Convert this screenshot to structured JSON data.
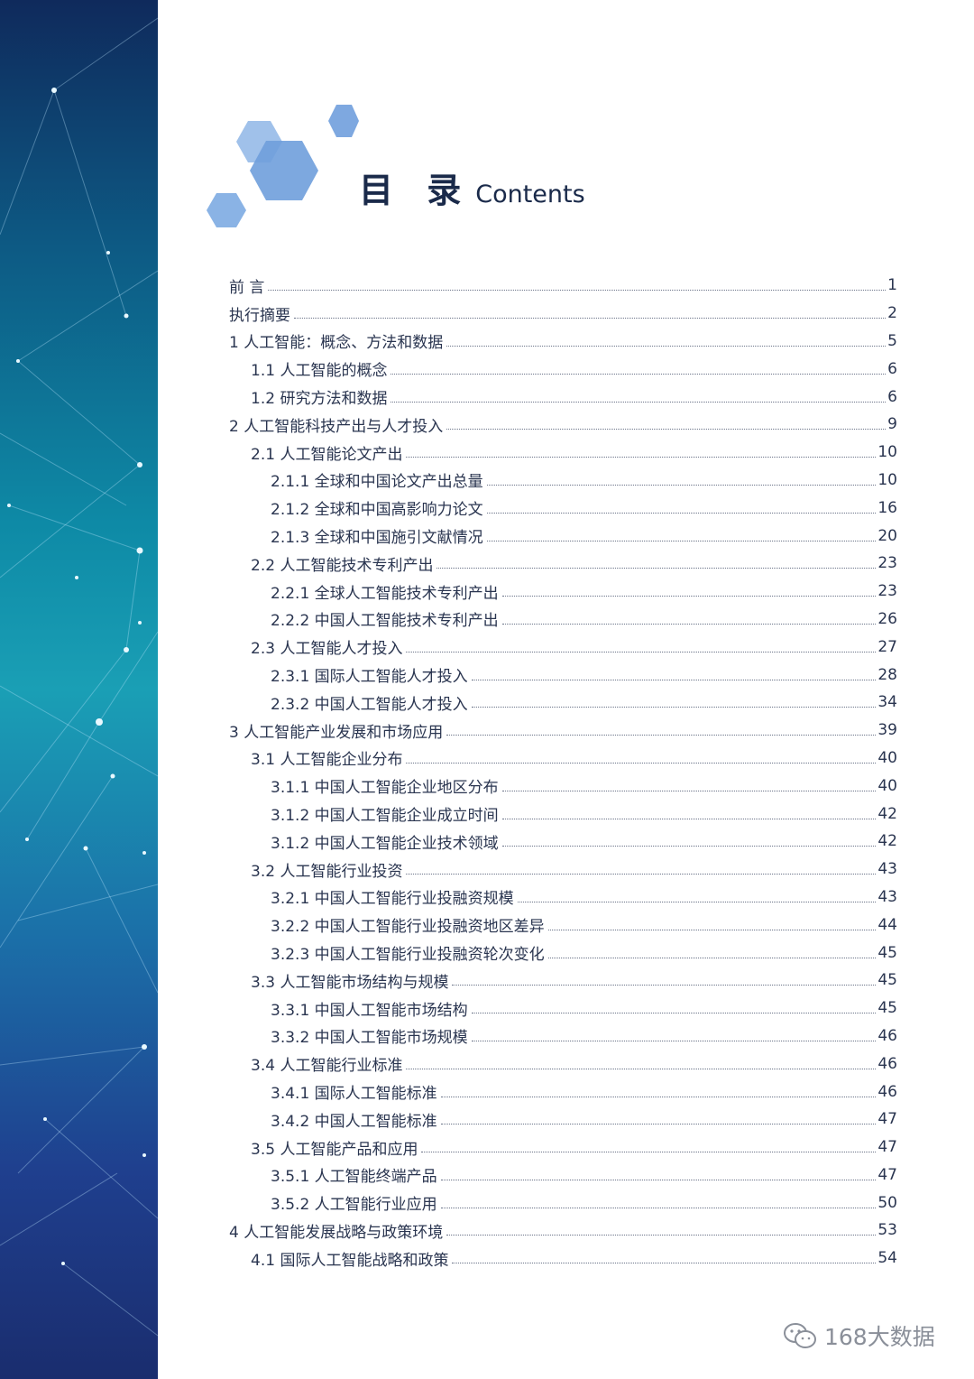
{
  "header": {
    "title_cn": "目 录",
    "title_en": "Contents"
  },
  "toc": [
    {
      "level": 1,
      "label": "前  言",
      "page": "1"
    },
    {
      "level": 1,
      "label": "执行摘要",
      "page": "2"
    },
    {
      "level": 1,
      "label": "1 人工智能：概念、方法和数据",
      "page": "5"
    },
    {
      "level": 2,
      "label": "1.1 人工智能的概念",
      "page": "6"
    },
    {
      "level": 2,
      "label": "1.2 研究方法和数据",
      "page": "6"
    },
    {
      "level": 1,
      "label": "2 人工智能科技产出与人才投入",
      "page": "9"
    },
    {
      "level": 2,
      "label": "2.1 人工智能论文产出",
      "page": "10"
    },
    {
      "level": 3,
      "label": "2.1.1 全球和中国论文产出总量",
      "page": "10"
    },
    {
      "level": 3,
      "label": "2.1.2 全球和中国高影响力论文",
      "page": "16"
    },
    {
      "level": 3,
      "label": "2.1.3 全球和中国施引文献情况",
      "page": "20"
    },
    {
      "level": 2,
      "label": "2.2 人工智能技术专利产出",
      "page": "23"
    },
    {
      "level": 3,
      "label": "2.2.1 全球人工智能技术专利产出",
      "page": "23"
    },
    {
      "level": 3,
      "label": "2.2.2 中国人工智能技术专利产出",
      "page": "26"
    },
    {
      "level": 2,
      "label": "2.3 人工智能人才投入",
      "page": "27"
    },
    {
      "level": 3,
      "label": "2.3.1 国际人工智能人才投入",
      "page": "28"
    },
    {
      "level": 3,
      "label": "2.3.2 中国人工智能人才投入",
      "page": "34"
    },
    {
      "level": 1,
      "label": "3 人工智能产业发展和市场应用",
      "page": "39"
    },
    {
      "level": 2,
      "label": "3.1 人工智能企业分布",
      "page": "40"
    },
    {
      "level": 3,
      "label": "3.1.1 中国人工智能企业地区分布",
      "page": "40"
    },
    {
      "level": 3,
      "label": "3.1.2 中国人工智能企业成立时间",
      "page": "42"
    },
    {
      "level": 3,
      "label": "3.1.2 中国人工智能企业技术领域",
      "page": "42"
    },
    {
      "level": 2,
      "label": "3.2 人工智能行业投资",
      "page": "43"
    },
    {
      "level": 3,
      "label": "3.2.1 中国人工智能行业投融资规模",
      "page": "43"
    },
    {
      "level": 3,
      "label": "3.2.2 中国人工智能行业投融资地区差异",
      "page": "44"
    },
    {
      "level": 3,
      "label": "3.2.3 中国人工智能行业投融资轮次变化",
      "page": "45"
    },
    {
      "level": 2,
      "label": "3.3 人工智能市场结构与规模",
      "page": "45"
    },
    {
      "level": 3,
      "label": "3.3.1 中国人工智能市场结构",
      "page": "45"
    },
    {
      "level": 3,
      "label": "3.3.2 中国人工智能市场规模",
      "page": "46"
    },
    {
      "level": 2,
      "label": "3.4 人工智能行业标准",
      "page": "46"
    },
    {
      "level": 3,
      "label": "3.4.1 国际人工智能标准",
      "page": "46"
    },
    {
      "level": 3,
      "label": "3.4.2 中国人工智能标准",
      "page": "47"
    },
    {
      "level": 2,
      "label": "3.5 人工智能产品和应用",
      "page": "47"
    },
    {
      "level": 3,
      "label": "3.5.1 人工智能终端产品",
      "page": "47"
    },
    {
      "level": 3,
      "label": "3.5.2 人工智能行业应用",
      "page": "50"
    },
    {
      "level": 1,
      "label": "4 人工智能发展战略与政策环境",
      "page": "53"
    },
    {
      "level": 2,
      "label": "4.1 国际人工智能战略和政策",
      "page": "54"
    }
  ],
  "watermark": {
    "text": "168大数据",
    "icon": "wechat-icon"
  },
  "colors": {
    "accent_hex": "#6f9fdc",
    "text": "#2a3550",
    "sidebar_top": "#0f2a5c",
    "sidebar_mid": "#1a9fb5",
    "sidebar_bottom": "#1a2d6e"
  }
}
